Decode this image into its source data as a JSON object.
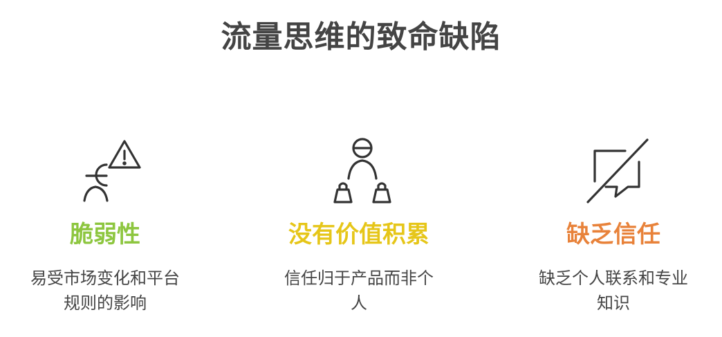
{
  "title": "流量思维的致命缺陷",
  "colors": {
    "title": "#444444",
    "icon_stroke": "#333333",
    "heading_1": "#8dc63f",
    "heading_2": "#e6c619",
    "heading_3": "#e8823a",
    "desc": "#444444"
  },
  "items": [
    {
      "icon": "person-warning-icon",
      "heading": "脆弱性",
      "desc_lines": [
        "易受市场变化和平台",
        "规则的影响"
      ]
    },
    {
      "icon": "person-bags-icon",
      "heading": "没有价值积累",
      "desc_lines": [
        "信任归于产品而非个",
        "人"
      ]
    },
    {
      "icon": "chat-slash-icon",
      "heading": "缺乏信任",
      "desc_lines": [
        "缺乏个人联系和专业",
        "知识"
      ]
    }
  ]
}
